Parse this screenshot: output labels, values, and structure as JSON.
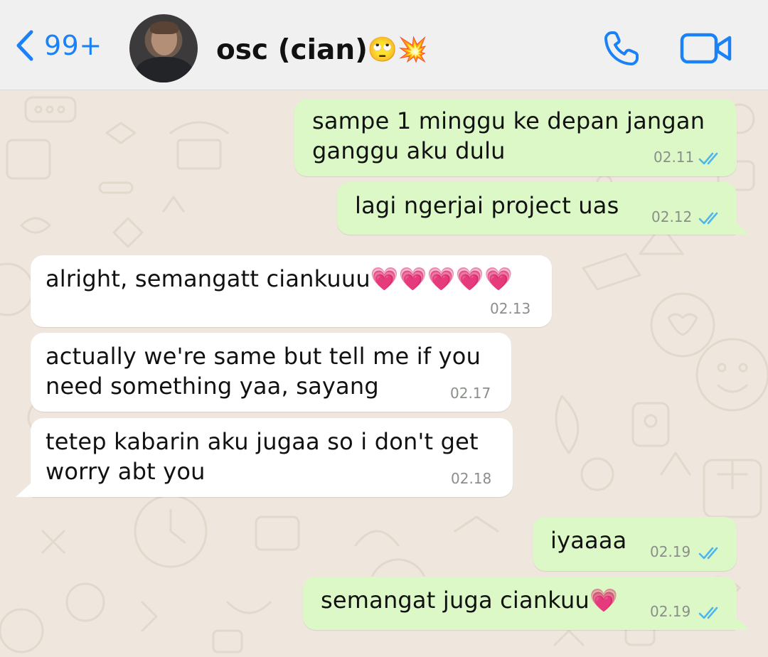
{
  "header": {
    "back_count": "99+",
    "contact_name": "osc (cian)",
    "contact_emojis": "🙄💥"
  },
  "messages": [
    {
      "id": 1,
      "direction": "outgoing",
      "text": "sampe 1 minggu ke depan jangan\nganggu aku dulu",
      "time": "02.11",
      "status": "read"
    },
    {
      "id": 2,
      "direction": "outgoing",
      "text": "lagi ngerjai project uas",
      "time": "02.12",
      "status": "read"
    },
    {
      "id": 3,
      "direction": "incoming",
      "text": "alright, semangatt ciankuuu💗💗💗💗💗",
      "time": "02.13"
    },
    {
      "id": 4,
      "direction": "incoming",
      "text": "actually we're same but tell me if you\nneed something yaa, sayang",
      "time": "02.17"
    },
    {
      "id": 5,
      "direction": "incoming",
      "text": "tetep kabarin aku jugaa so i don't get\nworry abt you",
      "time": "02.18"
    },
    {
      "id": 6,
      "direction": "outgoing",
      "text": "iyaaaa",
      "time": "02.19",
      "status": "read"
    },
    {
      "id": 7,
      "direction": "outgoing",
      "text": "semangat juga ciankuu💗",
      "time": "02.19",
      "status": "read"
    }
  ],
  "icons": {
    "back": "chevron-left-icon",
    "call": "phone-icon",
    "video": "video-camera-icon",
    "read_receipt": "double-check-icon"
  },
  "colors": {
    "accent": "#1a82f6",
    "outgoing_bubble": "#dcf8c6",
    "incoming_bubble": "#ffffff",
    "chat_background": "#efe7dd",
    "read_tick": "#4fb6ec"
  }
}
